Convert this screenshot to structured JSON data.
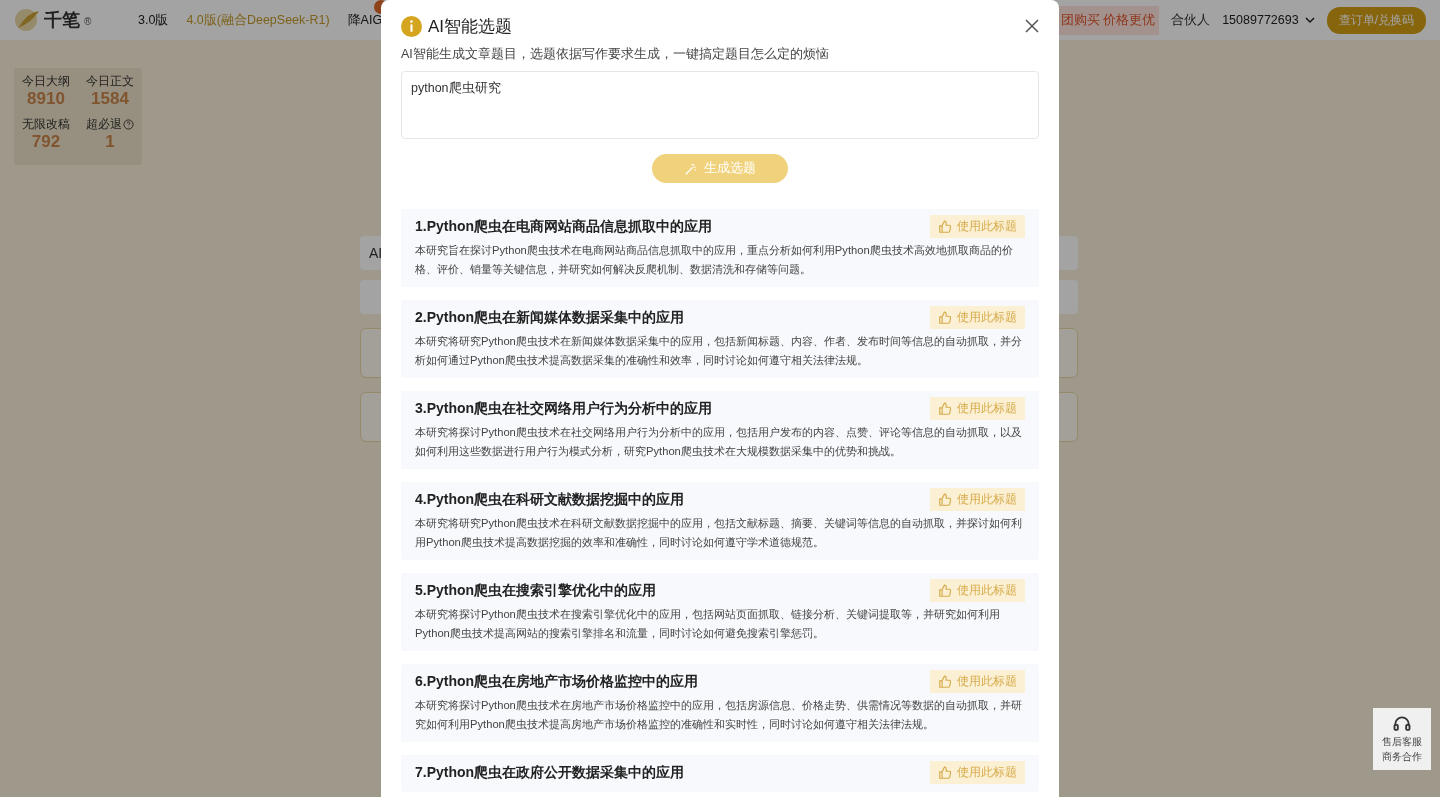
{
  "header": {
    "brand": "千笔",
    "brand_mark": "®",
    "nav": [
      {
        "label": "3.0版",
        "selected": false
      },
      {
        "label": "4.0版(融合DeepSeek-R1)",
        "selected": true
      },
      {
        "label": "降AIG",
        "selected": false
      }
    ],
    "right_links": [
      {
        "label": "团购买 价格更优",
        "kind": "promo"
      },
      {
        "label": "合伙人",
        "kind": "plain"
      }
    ],
    "account": "15089772693",
    "orders_button": "查订单/兑换码"
  },
  "stats": [
    {
      "label": "今日大纲",
      "value": "8910",
      "help": false
    },
    {
      "label": "今日正文",
      "value": "1584",
      "help": false
    },
    {
      "label": "无限改稿",
      "value": "792",
      "help": false
    },
    {
      "label": "超必退",
      "value": "1",
      "help": true
    }
  ],
  "background_field": "AI",
  "support": {
    "lines": [
      "售后客服",
      "商务合作"
    ]
  },
  "dialog": {
    "title": "AI智能选题",
    "subtitle": "AI智能生成文章题目，选题依据写作要求生成，一键搞定题目怎么定的烦恼",
    "input_value": "python爬虫研究",
    "generate_button": "生成选题",
    "topics": [
      {
        "title": "1.Python爬虫在电商网站商品信息抓取中的应用",
        "description": "本研究旨在探讨Python爬虫技术在电商网站商品信息抓取中的应用，重点分析如何利用Python爬虫技术高效地抓取商品的价格、评价、销量等关键信息，并研究如何解决反爬机制、数据清洗和存储等问题。",
        "action": "使用此标题"
      },
      {
        "title": "2.Python爬虫在新闻媒体数据采集中的应用",
        "description": "本研究将研究Python爬虫技术在新闻媒体数据采集中的应用，包括新闻标题、内容、作者、发布时间等信息的自动抓取，并分析如何通过Python爬虫技术提高数据采集的准确性和效率，同时讨论如何遵守相关法律法规。",
        "action": "使用此标题"
      },
      {
        "title": "3.Python爬虫在社交网络用户行为分析中的应用",
        "description": "本研究将探讨Python爬虫技术在社交网络用户行为分析中的应用，包括用户发布的内容、点赞、评论等信息的自动抓取，以及如何利用这些数据进行用户行为模式分析，研究Python爬虫技术在大规模数据采集中的优势和挑战。",
        "action": "使用此标题"
      },
      {
        "title": "4.Python爬虫在科研文献数据挖掘中的应用",
        "description": "本研究将研究Python爬虫技术在科研文献数据挖掘中的应用，包括文献标题、摘要、关键词等信息的自动抓取，并探讨如何利用Python爬虫技术提高数据挖掘的效率和准确性，同时讨论如何遵守学术道德规范。",
        "action": "使用此标题"
      },
      {
        "title": "5.Python爬虫在搜索引擎优化中的应用",
        "description": "本研究将探讨Python爬虫技术在搜索引擎优化中的应用，包括网站页面抓取、链接分析、关键词提取等，并研究如何利用Python爬虫技术提高网站的搜索引擎排名和流量，同时讨论如何避免搜索引擎惩罚。",
        "action": "使用此标题"
      },
      {
        "title": "6.Python爬虫在房地产市场价格监控中的应用",
        "description": "本研究将探讨Python爬虫技术在房地产市场价格监控中的应用，包括房源信息、价格走势、供需情况等数据的自动抓取，并研究如何利用Python爬虫技术提高房地产市场价格监控的准确性和实时性，同时讨论如何遵守相关法律法规。",
        "action": "使用此标题"
      },
      {
        "title": "7.Python爬虫在政府公开数据采集中的应用",
        "action": "使用此标题"
      }
    ]
  }
}
